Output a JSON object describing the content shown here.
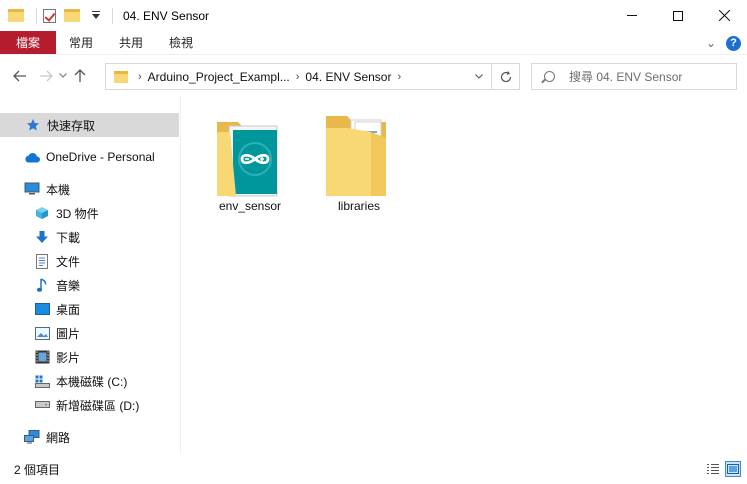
{
  "window": {
    "title": "04. ENV Sensor"
  },
  "ribbon": {
    "tabs": [
      "檔案",
      "常用",
      "共用",
      "檢視"
    ]
  },
  "address": {
    "crumbs": [
      "Arduino_Project_Exampl...",
      "04. ENV Sensor"
    ]
  },
  "search": {
    "placeholder": "搜尋 04. ENV Sensor"
  },
  "sidebar": {
    "quick_access": "快速存取",
    "onedrive": "OneDrive - Personal",
    "this_pc": "本機",
    "items": [
      "3D 物件",
      "下載",
      "文件",
      "音樂",
      "桌面",
      "圖片",
      "影片",
      "本機磁碟 (C:)",
      "新增磁碟區 (D:)"
    ],
    "network": "網路"
  },
  "files": [
    {
      "name": "env_sensor",
      "icon": "arduino-folder-icon"
    },
    {
      "name": "libraries",
      "icon": "documents-folder-icon"
    }
  ],
  "status": {
    "count": "2 個項目"
  },
  "colors": {
    "file_tab": "#b51c2c",
    "arduino_teal": "#00979c",
    "folder": "#f8d775"
  }
}
